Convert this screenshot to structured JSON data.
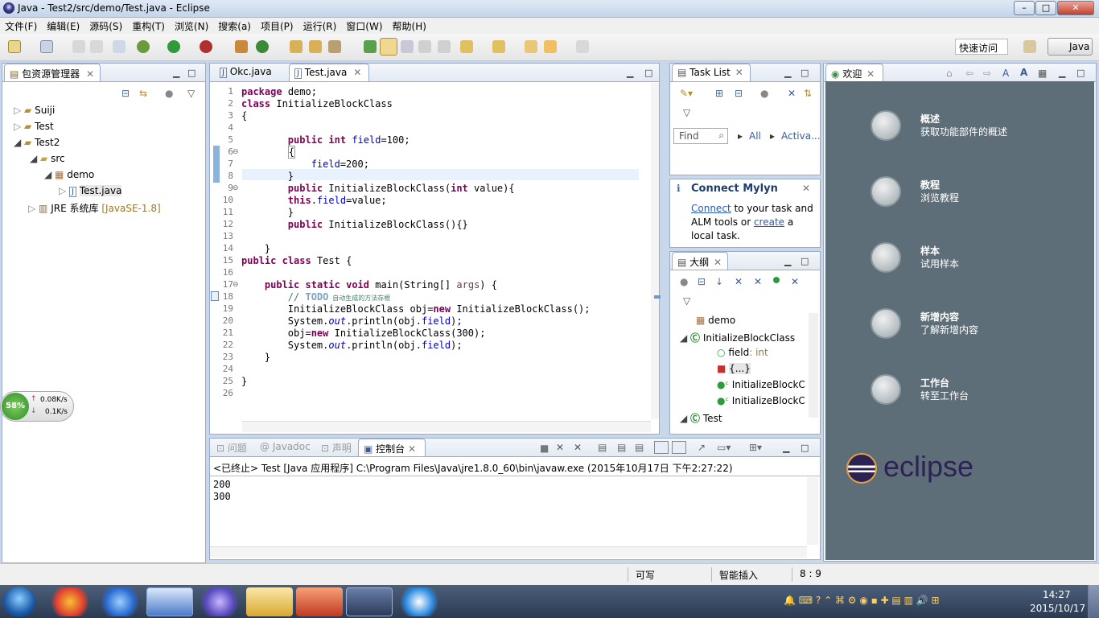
{
  "window": {
    "title": "Java - Test2/src/demo/Test.java - Eclipse",
    "min": "–",
    "max": "□",
    "close": "✕"
  },
  "menu": [
    "文件(F)",
    "编辑(E)",
    "源码(S)",
    "重构(T)",
    "浏览(N)",
    "搜索(a)",
    "项目(P)",
    "运行(R)",
    "窗口(W)",
    "帮助(H)"
  ],
  "toolbar": {
    "quick_access": "快速访问",
    "perspective": "Java"
  },
  "package_explorer": {
    "title": "包资源管理器",
    "items": [
      {
        "label": "Suiji"
      },
      {
        "label": "Test"
      },
      {
        "label": "Test2"
      },
      {
        "label": "src"
      },
      {
        "label": "demo"
      },
      {
        "label": "Test.java"
      },
      {
        "label": "JRE 系统库",
        "suffix": "[JavaSE-1.8]"
      }
    ]
  },
  "editor": {
    "tabs": [
      "Okc.java",
      "Test.java"
    ],
    "line_numbers": [
      "1",
      "2",
      "3",
      "4",
      "5",
      "6",
      "7",
      "8",
      "9",
      "10",
      "11",
      "12",
      "13",
      "14",
      "15",
      "16",
      "17",
      "18",
      "19",
      "20",
      "21",
      "22",
      "23",
      "24",
      "25",
      "26"
    ],
    "line1": "demo;",
    "line2": "InitializeBlockClass",
    "line3": "{",
    "line5_num": "=100;",
    "line6": "{",
    "line7_num": "=200;",
    "line8": "}",
    "line9_a": "InitializeBlockClass(",
    "line9_b": " value){",
    "line10": "=value;",
    "line11": "}",
    "line12": "InitializeBlockClass(){}",
    "line14": "}",
    "line15": "Test {",
    "line17_a": "main(String[] ",
    "line17_b": "args",
    "line17_c": ") {",
    "line18_todo": "TODO",
    "line18_rest": " 自动生成的方法存根",
    "line19": "InitializeBlockClass obj=",
    "line19_b": " InitializeBlockClass();",
    "line20_a": "System.",
    "line20_b": ".println(obj.",
    "line20_c": ");",
    "line21_a": "obj=",
    "line21_b": " InitializeBlockClass(300);",
    "line23": "}",
    "line25": "}"
  },
  "task_list": {
    "title": "Task List",
    "find": "Find",
    "all": "All",
    "activate": "Activa..."
  },
  "mylyn": {
    "title": "Connect Mylyn",
    "connect": "Connect",
    "text1": " to your task and",
    "text2": "ALM tools or ",
    "create": "create",
    "text3": " a",
    "text4": "local task."
  },
  "outline": {
    "title": "大纲",
    "items": [
      "demo",
      "InitializeBlockClass",
      "field",
      ": int",
      "{...}",
      "InitializeBlockC",
      "InitializeBlockC",
      "Test"
    ]
  },
  "welcome": {
    "tab": "欢迎",
    "items": [
      {
        "title": "概述",
        "sub": "获取功能部件的概述"
      },
      {
        "title": "教程",
        "sub": "浏览教程"
      },
      {
        "title": "样本",
        "sub": "试用样本"
      },
      {
        "title": "新增内容",
        "sub": "了解新增内容"
      },
      {
        "title": "工作台",
        "sub": "转至工作台"
      }
    ],
    "logo": "eclipse"
  },
  "console": {
    "tabs": [
      "问题",
      "Javadoc",
      "声明",
      "控制台"
    ],
    "header": "<已终止> Test [Java 应用程序] C:\\Program Files\\Java\\jre1.8.0_60\\bin\\javaw.exe (2015年10月17日 下午2:27:22)",
    "output": [
      "200",
      "300"
    ]
  },
  "status": {
    "writable": "可写",
    "insert": "智能插入",
    "position": "8 : 9"
  },
  "netwidget": {
    "percent": "58%",
    "up": "0.08K/s",
    "down": "0.1K/s"
  },
  "taskbar": {
    "time": "14:27",
    "date": "2015/10/17"
  }
}
